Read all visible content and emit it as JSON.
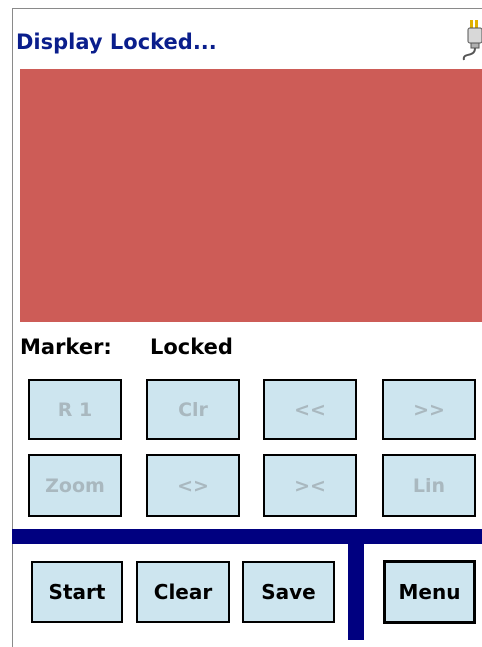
{
  "window": {
    "title": "Display Locked..."
  },
  "status": {
    "icon": "power-plug-icon"
  },
  "colors": {
    "display": "#cd5c57",
    "title": "#0a1e8c",
    "bar": "#000080",
    "button_bg": "#cde5ef"
  },
  "marker": {
    "label": "Marker:",
    "value": "Locked"
  },
  "controls": {
    "row1": [
      "R 1",
      "Clr",
      "<<",
      ">>"
    ],
    "row2": [
      "Zoom",
      "<>",
      "><",
      "Lin"
    ]
  },
  "actions": {
    "start": "Start",
    "clear": "Clear",
    "save": "Save",
    "menu": "Menu"
  }
}
